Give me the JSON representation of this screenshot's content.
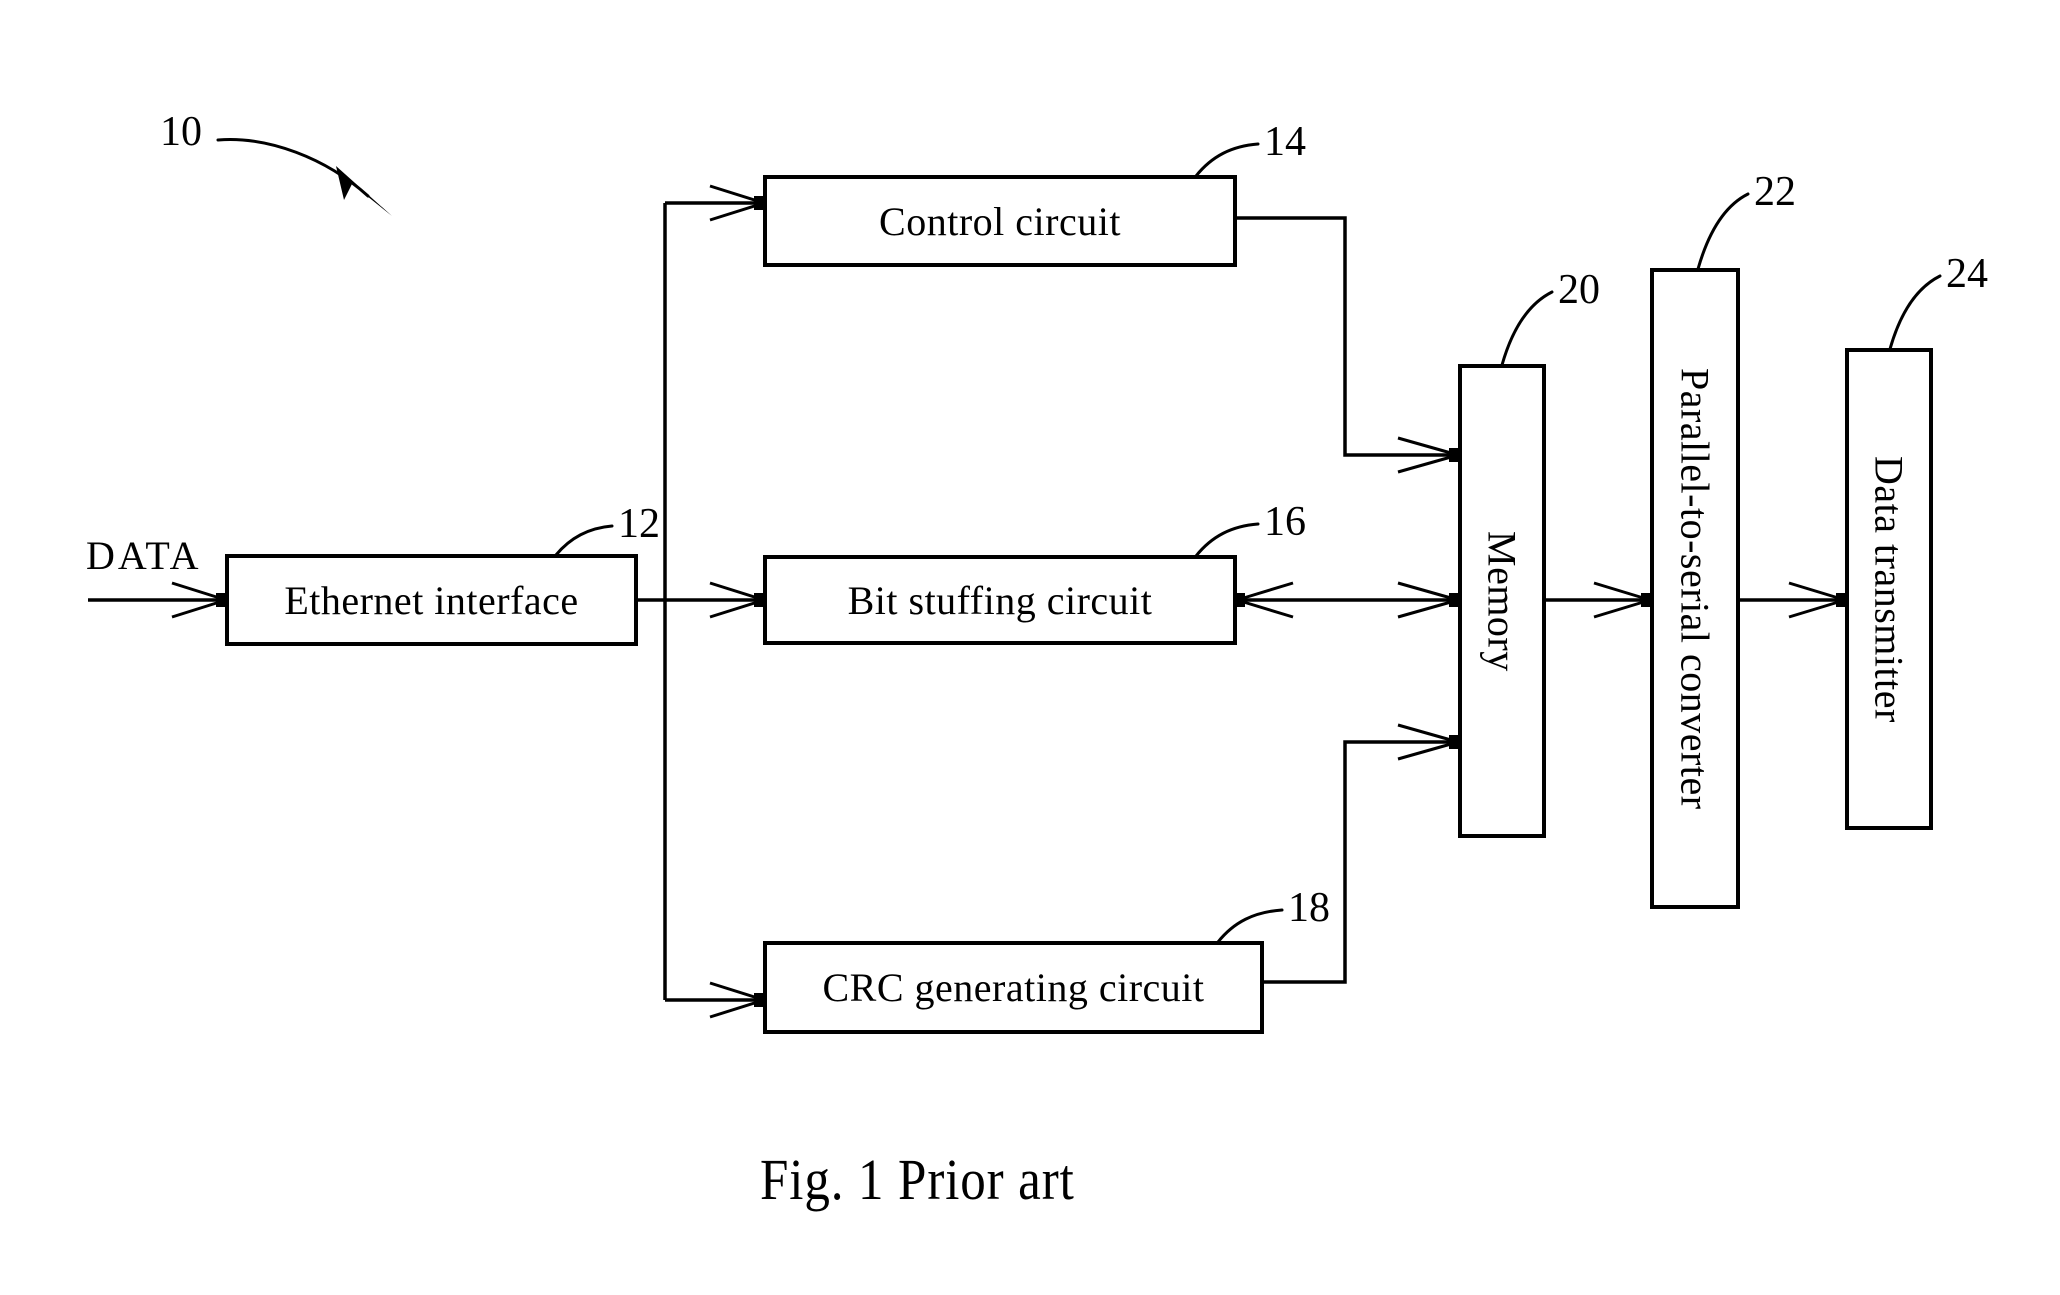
{
  "figure": {
    "caption": "Fig. 1 Prior art",
    "system_ref": "10",
    "input_label": "DATA"
  },
  "blocks": [
    {
      "id": "ethernet",
      "label": "Ethernet interface",
      "ref": "12",
      "orientation": "horizontal"
    },
    {
      "id": "control",
      "label": "Control circuit",
      "ref": "14",
      "orientation": "horizontal"
    },
    {
      "id": "bitstuff",
      "label": "Bit stuffing circuit",
      "ref": "16",
      "orientation": "horizontal"
    },
    {
      "id": "crc",
      "label": "CRC generating circuit",
      "ref": "18",
      "orientation": "horizontal"
    },
    {
      "id": "memory",
      "label": "Memory",
      "ref": "20",
      "orientation": "vertical"
    },
    {
      "id": "p2s",
      "label": "Parallel-to-serial converter",
      "ref": "22",
      "orientation": "vertical"
    },
    {
      "id": "datatx",
      "label": "Data transmitter",
      "ref": "24",
      "orientation": "vertical"
    }
  ],
  "connections": [
    {
      "from": "DATA",
      "to": "ethernet",
      "kind": "arrow"
    },
    {
      "from": "ethernet",
      "to": "control",
      "kind": "arrow"
    },
    {
      "from": "ethernet",
      "to": "bitstuff",
      "kind": "arrow"
    },
    {
      "from": "ethernet",
      "to": "crc",
      "kind": "arrow"
    },
    {
      "from": "control",
      "to": "memory",
      "kind": "arrow"
    },
    {
      "from": "bitstuff",
      "to": "memory",
      "kind": "bidirectional"
    },
    {
      "from": "crc",
      "to": "memory",
      "kind": "arrow"
    },
    {
      "from": "memory",
      "to": "p2s",
      "kind": "arrow"
    },
    {
      "from": "p2s",
      "to": "datatx",
      "kind": "arrow"
    }
  ],
  "colors": {
    "ink": "#000000",
    "paper": "#ffffff"
  }
}
